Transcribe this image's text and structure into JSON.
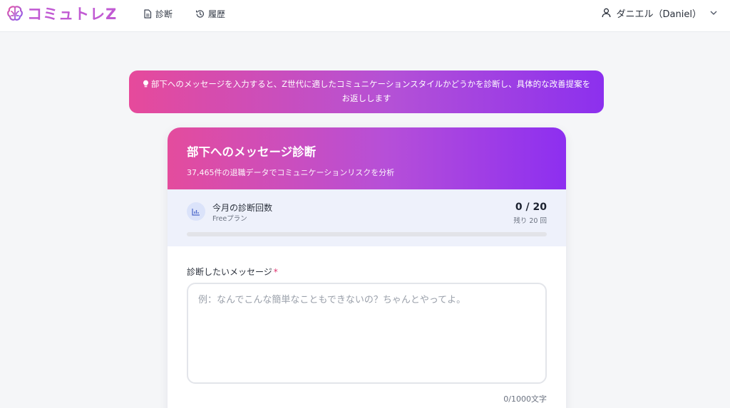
{
  "header": {
    "brand": "コミュトレZ",
    "nav": [
      {
        "label": "診断",
        "icon": "document-icon"
      },
      {
        "label": "履歴",
        "icon": "history-icon"
      }
    ],
    "user": "ダニエル（Daniel）"
  },
  "banner": {
    "text": "部下へのメッセージを入力すると、Z世代に適したコミュニケーションスタイルかどうかを診断し、具体的な改善提案をお返しします",
    "icon": "lightbulb-icon"
  },
  "card": {
    "title": "部下へのメッセージ診断",
    "subtitle": "37,465件の退職データでコミュニケーションリスクを分析"
  },
  "usage": {
    "label": "今月の診断回数",
    "plan": "Freeプラン",
    "count": "0 / 20",
    "remaining": "残り 20 回",
    "used_fraction": 0
  },
  "form": {
    "label": "診断したいメッセージ",
    "required_mark": "*",
    "placeholder": "例：なんでこんな簡単なこともできないの？ちゃんとやってよ。",
    "value": "",
    "char_count": "0/1000文字"
  },
  "colors": {
    "gradient_start": "#e64a9b",
    "gradient_end": "#8c30ee",
    "page_background": "#f5f6f8"
  }
}
